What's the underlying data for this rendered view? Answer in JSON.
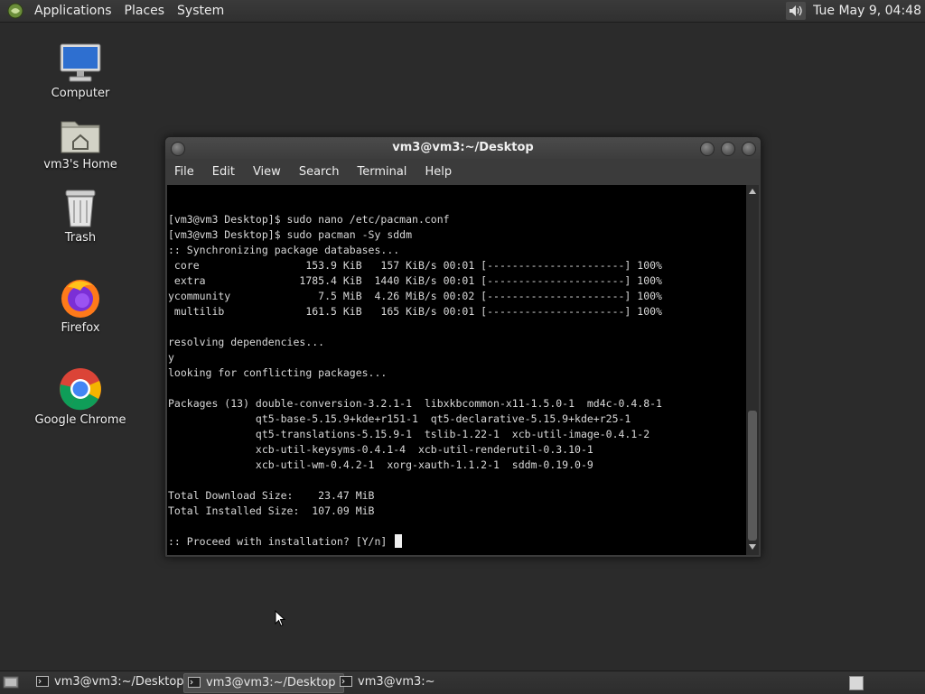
{
  "top_panel": {
    "menus": [
      "Applications",
      "Places",
      "System"
    ],
    "clock": "Tue May  9, 04:48"
  },
  "desktop_icons": [
    {
      "label": "Computer",
      "icon": "computer-icon"
    },
    {
      "label": "vm3's Home",
      "icon": "home-folder-icon"
    },
    {
      "label": "Trash",
      "icon": "trash-icon"
    },
    {
      "label": "Firefox",
      "icon": "firefox-icon"
    },
    {
      "label": "Google Chrome",
      "icon": "chrome-icon"
    }
  ],
  "window": {
    "title": "vm3@vm3:~/Desktop",
    "menu": [
      "File",
      "Edit",
      "View",
      "Search",
      "Terminal",
      "Help"
    ]
  },
  "terminal": {
    "lines": [
      "[vm3@vm3 Desktop]$ sudo nano /etc/pacman.conf",
      "[vm3@vm3 Desktop]$ sudo pacman -Sy sddm",
      ":: Synchronizing package databases...",
      " core                 153.9 KiB   157 KiB/s 00:01 [----------------------] 100%",
      " extra               1785.4 KiB  1440 KiB/s 00:01 [----------------------] 100%",
      "ycommunity              7.5 MiB  4.26 MiB/s 00:02 [----------------------] 100%",
      " multilib             161.5 KiB   165 KiB/s 00:01 [----------------------] 100%",
      "",
      "resolving dependencies...",
      "y",
      "looking for conflicting packages...",
      "",
      "Packages (13) double-conversion-3.2.1-1  libxkbcommon-x11-1.5.0-1  md4c-0.4.8-1",
      "              qt5-base-5.15.9+kde+r151-1  qt5-declarative-5.15.9+kde+r25-1",
      "              qt5-translations-5.15.9-1  tslib-1.22-1  xcb-util-image-0.4.1-2",
      "              xcb-util-keysyms-0.4.1-4  xcb-util-renderutil-0.3.10-1",
      "              xcb-util-wm-0.4.2-1  xorg-xauth-1.1.2-1  sddm-0.19.0-9",
      "",
      "Total Download Size:    23.47 MiB",
      "Total Installed Size:  107.09 MiB",
      ""
    ],
    "prompt": ":: Proceed with installation? [Y/n] "
  },
  "taskbar": {
    "tasks": [
      {
        "label": "vm3@vm3:~/Desktop",
        "active": false
      },
      {
        "label": "vm3@vm3:~/Desktop",
        "active": true
      },
      {
        "label": "vm3@vm3:~",
        "active": false
      }
    ]
  }
}
